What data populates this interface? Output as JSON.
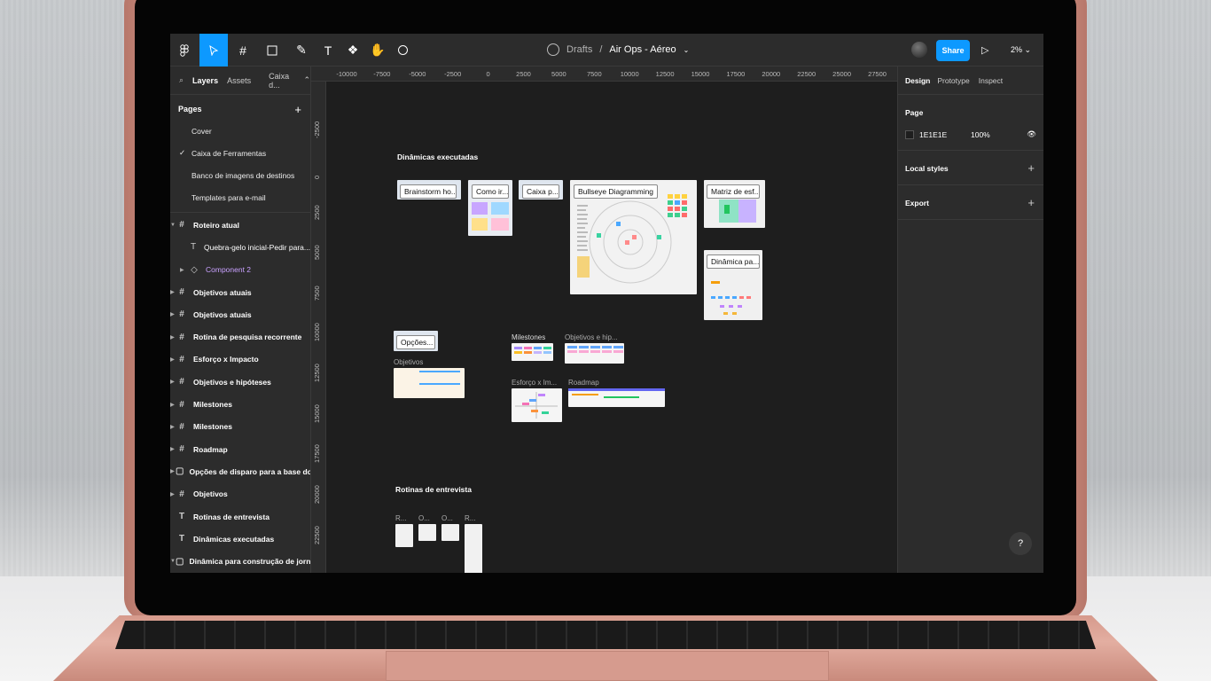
{
  "toolbar": {
    "breadcrumb_project": "Drafts",
    "breadcrumb_sep": "/",
    "file_name": "Air Ops - Aéreo",
    "share_label": "Share",
    "zoom": "2%"
  },
  "left_panel": {
    "tabs": [
      "Layers",
      "Assets",
      "Caixa d..."
    ],
    "pages_title": "Pages",
    "pages": [
      "Cover",
      "Caixa de Ferramentas",
      "Banco de imagens de destinos",
      "Templates para e-mail"
    ],
    "current_page_index": 1,
    "layers": [
      {
        "label": "Roteiro atual",
        "icon": "#"
      },
      {
        "label": "Quebra-gelo inicial-Pedir para...",
        "icon": "T"
      },
      {
        "label": "Component 2",
        "icon": "◇"
      },
      {
        "label": "Objetivos atuais",
        "icon": "#"
      },
      {
        "label": "Objetivos atuais",
        "icon": "#"
      },
      {
        "label": "Rotina de pesquisa recorrente",
        "icon": "#"
      },
      {
        "label": "Esforço x Impacto",
        "icon": "#"
      },
      {
        "label": "Objetivos e hipóteses",
        "icon": "#"
      },
      {
        "label": "Milestones",
        "icon": "#"
      },
      {
        "label": "Milestones",
        "icon": "#"
      },
      {
        "label": "Roadmap",
        "icon": "#"
      },
      {
        "label": "Opções de disparo para a base do...",
        "icon": "▢"
      },
      {
        "label": "Objetivos",
        "icon": "#"
      },
      {
        "label": "Rotinas de entrevista",
        "icon": "T"
      },
      {
        "label": "Dinâmicas executadas",
        "icon": "T"
      },
      {
        "label": "Dinâmica para construção de jorn...",
        "icon": "▢"
      }
    ]
  },
  "right_panel": {
    "tabs": [
      "Design",
      "Prototype",
      "Inspect"
    ],
    "page_title": "Page",
    "bg_hex": "1E1E1E",
    "bg_opacity": "100%",
    "local_styles": "Local styles",
    "export": "Export",
    "help": "?"
  },
  "ruler": {
    "top": [
      "-10000",
      "-7500",
      "-5000",
      "-2500",
      "0",
      "2500",
      "5000",
      "7500",
      "10000",
      "12500",
      "15000",
      "17500",
      "20000",
      "22500",
      "25000",
      "27500"
    ],
    "left": [
      "-2500",
      "0",
      "2500",
      "5000",
      "7500",
      "10000",
      "12500",
      "15000",
      "17500",
      "20000",
      "22500"
    ]
  },
  "canvas": {
    "section_dinamicas": "Dinâmicas executadas",
    "section_rotinas": "Rotinas de entrevista",
    "tags": {
      "brainstorm": "Brainstorm ho...",
      "como": "Como ir...",
      "caixa": "Caixa p...",
      "bullseye": "Bullseye Diagramming",
      "matriz": "Matriz de esf...",
      "dinamica": "Dinâmica pa...",
      "opcoes": "Opções..."
    },
    "labels": {
      "objetivos": "Objetivos",
      "milestones": "Milestones",
      "objetivos_hip": "Objetivos e hip...",
      "esforco": "Esforço x Im...",
      "roadmap": "Roadmap",
      "r1": "R...",
      "o1": "O...",
      "o2": "O...",
      "r2": "R..."
    }
  },
  "colors": {
    "accent": "#0d99ff",
    "canvas": "#1e1e1e",
    "panel": "#2c2c2c"
  }
}
